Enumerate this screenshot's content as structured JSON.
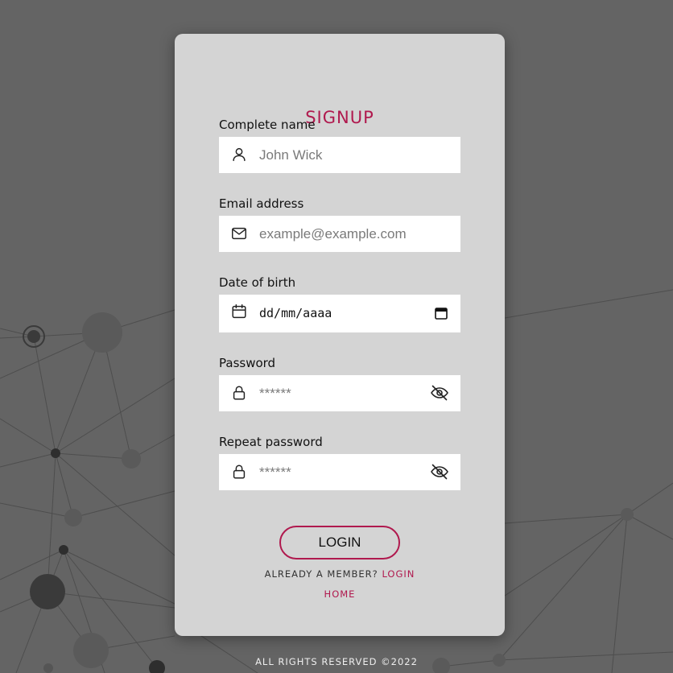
{
  "page": {
    "title": "SIGNUP",
    "accent_color": "#b0194e",
    "background_color": "#646464",
    "card_color": "#d4d4d4"
  },
  "fields": {
    "name": {
      "label": "Complete name",
      "placeholder": "John Wick",
      "icon": "user-icon"
    },
    "email": {
      "label": "Email address",
      "placeholder": "example@example.com",
      "icon": "envelope-icon"
    },
    "dob": {
      "label": "Date of birth",
      "value": "dd/mm/aaaa",
      "icon": "calendar-icon"
    },
    "password": {
      "label": "Password",
      "placeholder": "******",
      "icon": "lock-icon",
      "toggle_icon": "eye-off-icon"
    },
    "repeat_password": {
      "label": "Repeat password",
      "placeholder": "******",
      "icon": "lock-icon",
      "toggle_icon": "eye-off-icon"
    }
  },
  "actions": {
    "submit_label": "LOGIN",
    "member_text": "ALREADY A MEMBER?",
    "member_link": "LOGIN",
    "home_link": "HOME"
  },
  "footer": {
    "text": "ALL RIGHTS RESERVED ©2022"
  }
}
